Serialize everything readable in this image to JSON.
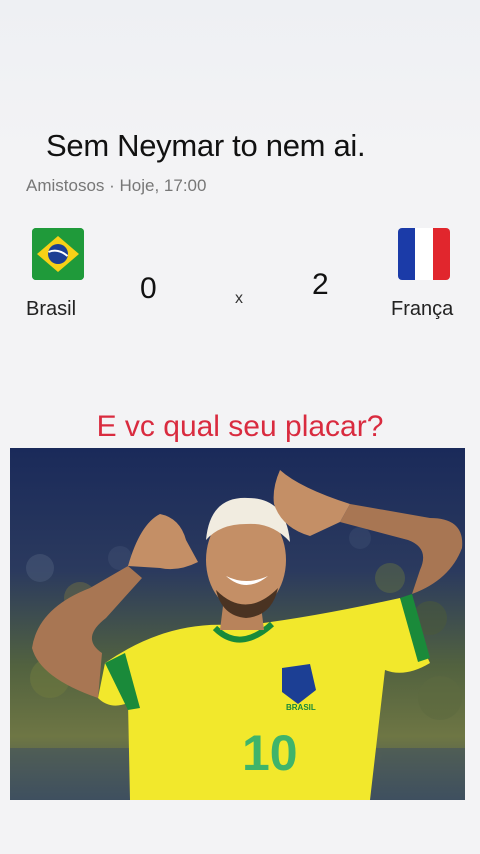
{
  "post": {
    "caption": "Sem Neymar to nem ai.",
    "question": "E vc qual seu placar?"
  },
  "match": {
    "meta": "Amistosos · Hoje, 17:00",
    "home": {
      "name": "Brasil",
      "score": "0",
      "flag": "brazil-flag-icon"
    },
    "away": {
      "name": "França",
      "score": "2",
      "flag": "france-flag-icon"
    },
    "separator": "x"
  },
  "photo": {
    "jersey_number": "10",
    "badge_text": "BRASIL"
  },
  "colors": {
    "question": "#d92b3f",
    "brazil_green": "#1f9a3a",
    "brazil_yellow": "#f7d117",
    "brazil_blue": "#1c3f94",
    "france_blue": "#1b3ba8",
    "france_red": "#e1262d",
    "jersey": "#f2e82c"
  }
}
